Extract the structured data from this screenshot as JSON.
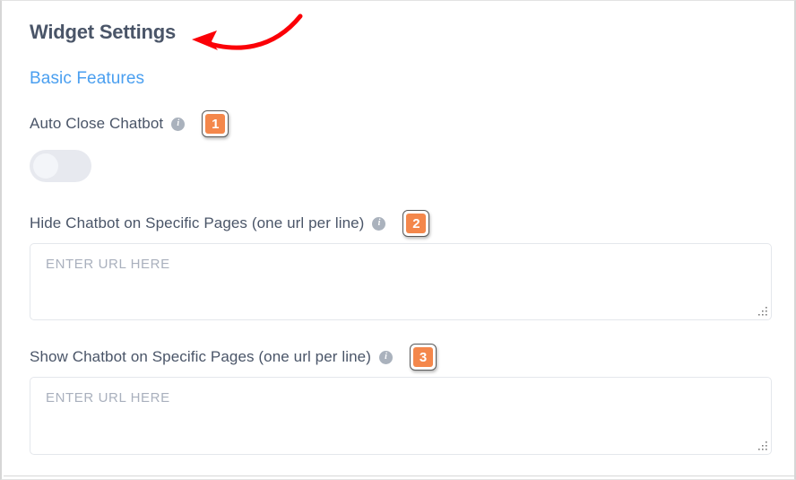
{
  "panel": {
    "title": "Widget Settings",
    "section_title": "Basic Features",
    "accent_color": "#4a9ff0",
    "title_color": "#4a5568",
    "badge_color": "#f4874b",
    "annotation_arrow_color": "#fb0007"
  },
  "fields": [
    {
      "label": "Auto Close Chatbot",
      "info_icon": "info-icon",
      "badge": "1",
      "control": "toggle",
      "toggle_state": "off"
    },
    {
      "label": "Hide Chatbot on Specific Pages (one url per line)",
      "info_icon": "info-icon",
      "badge": "2",
      "control": "textarea",
      "value": "",
      "placeholder": "ENTER URL HERE"
    },
    {
      "label": "Show Chatbot on Specific Pages (one url per line)",
      "info_icon": "info-icon",
      "badge": "3",
      "control": "textarea",
      "value": "",
      "placeholder": "ENTER URL HERE"
    }
  ],
  "annotation": {
    "type": "curved-arrow",
    "points_to": "Widget Settings"
  }
}
